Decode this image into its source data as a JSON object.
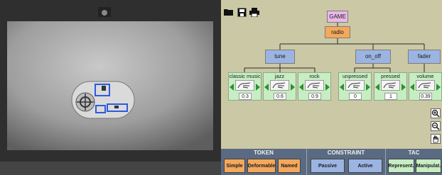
{
  "camera": {
    "tags_detected": 3
  },
  "toolbar": {
    "items": [
      {
        "name": "open-folder-icon"
      },
      {
        "name": "save-icon"
      },
      {
        "name": "print-icon"
      }
    ]
  },
  "tree": {
    "root": "GAME",
    "child": "radio",
    "categories": [
      "tune",
      "on_off",
      "fader"
    ],
    "tokens": [
      {
        "label": "classic music",
        "value": "0.3"
      },
      {
        "label": "jazz",
        "value": "0.6"
      },
      {
        "label": "rock",
        "value": "0.9"
      },
      {
        "label": "unpressed",
        "value": "0"
      },
      {
        "label": "pressed",
        "value": "1"
      },
      {
        "label": "volume",
        "value": "0.39"
      }
    ]
  },
  "zoom_tools": [
    "zoom-in-icon",
    "zoom-out-icon",
    "hand-pan-icon"
  ],
  "palette": {
    "groups": [
      {
        "title": "TOKEN",
        "buttons": [
          "Simple",
          "Deformable",
          "Named"
        ]
      },
      {
        "title": "CONSTRAINT",
        "buttons": [
          "Passive",
          "Active"
        ]
      },
      {
        "title": "TAC",
        "buttons": [
          "Represent.",
          "Manipulat."
        ]
      }
    ]
  },
  "colors": {
    "editor_bg": "#cbc8a5",
    "root_node": "#e8b8e8",
    "radio_node": "#f3a85c",
    "category_node": "#9cb4e2",
    "token_bg": "#c7edc3",
    "token_button": "#f3a85c",
    "constraint_button": "#9cb4e2",
    "tac_button": "#c7edc3",
    "palette_bg": "#5a6a82",
    "tag_outline": "#2b5be0"
  }
}
